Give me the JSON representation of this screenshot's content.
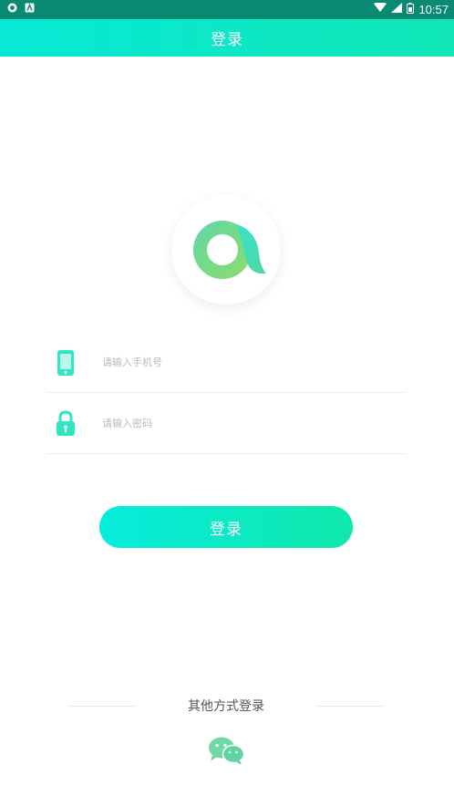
{
  "status_bar": {
    "time": "10:57"
  },
  "header": {
    "title": "登录"
  },
  "form": {
    "phone_placeholder": "请输入手机号",
    "password_placeholder": "请输入密码"
  },
  "login_button": {
    "label": "登录"
  },
  "other_login": {
    "label": "其他方式登录"
  },
  "icons": {
    "phone": "phone-icon",
    "lock": "lock-icon",
    "wechat": "wechat-icon",
    "logo": "app-logo-icon"
  },
  "colors": {
    "accent_start": "#05ecdc",
    "accent_end": "#10e8ab",
    "status_bar": "#0a8a73"
  }
}
